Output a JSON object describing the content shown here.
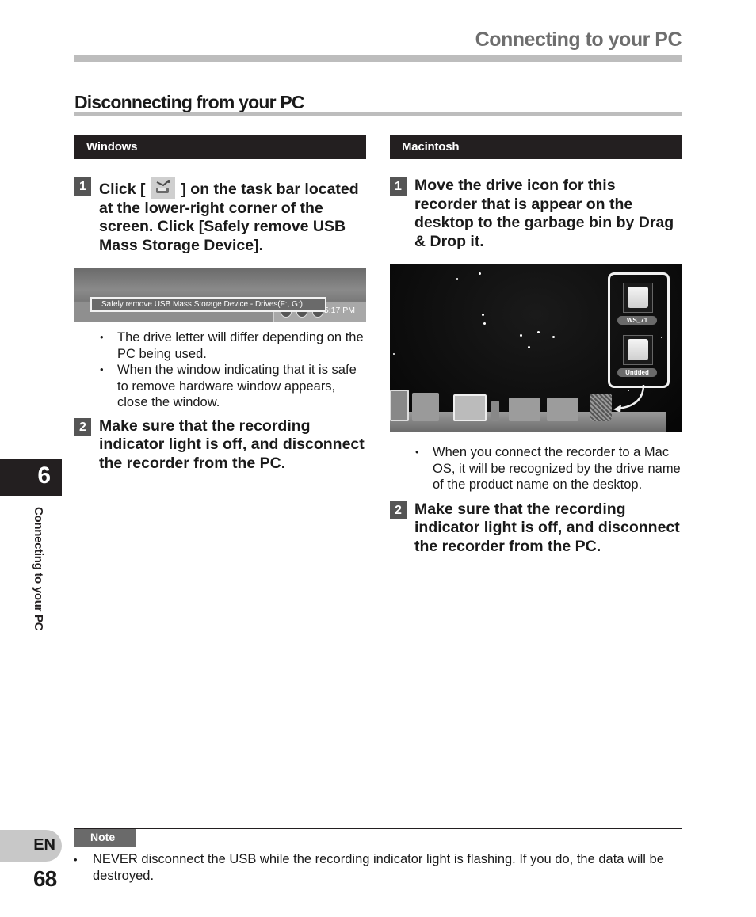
{
  "header": {
    "chapter_title": "Connecting to your PC"
  },
  "section": {
    "title": "Disconnecting from your PC"
  },
  "windows": {
    "os_label": "Windows",
    "step1": {
      "number": "1",
      "text_before_icon": "Click [",
      "icon": "safely-remove-hardware-icon",
      "text_after_icon": "] on the task bar located at the lower-right corner of the screen. Click [Safely remove USB Mass Storage Device]."
    },
    "screenshot": {
      "tooltip": "Safely remove USB Mass Storage Device - Drives(F:, G:)",
      "clock": "5:17 PM"
    },
    "bullets": [
      "The drive letter will differ depending on the PC being used.",
      "When the window indicating that it is safe to remove hardware window appears, close the window."
    ],
    "step2": {
      "number": "2",
      "text": "Make sure that the recording indicator light is off, and disconnect the recorder from the PC."
    }
  },
  "macintosh": {
    "os_label": "Macintosh",
    "step1": {
      "number": "1",
      "text": "Move the drive icon for this recorder that is appear on the desktop to the garbage bin by Drag & Drop it."
    },
    "screenshot": {
      "drives": [
        "WS_71",
        "Untitled"
      ],
      "dock_items": [
        "finder-window-icon",
        "disk-utility-icon",
        "preview-scissors-icon",
        "stack-icon",
        "folder-icon",
        "downloads-folder-icon",
        "trash-icon"
      ]
    },
    "bullets": [
      "When you connect the recorder to a Mac OS, it will be recognized by the drive name of the product name on the desktop."
    ],
    "step2": {
      "number": "2",
      "text": "Make sure that the recording indicator light is off, and disconnect the recorder from the PC."
    }
  },
  "side": {
    "chapter_number": "6",
    "chapter_label": "Connecting to your PC",
    "language": "EN",
    "page_number": "68"
  },
  "note": {
    "label": "Note",
    "text": "NEVER disconnect the USB while the recording indicator light is flashing. If you do, the data will be destroyed."
  }
}
